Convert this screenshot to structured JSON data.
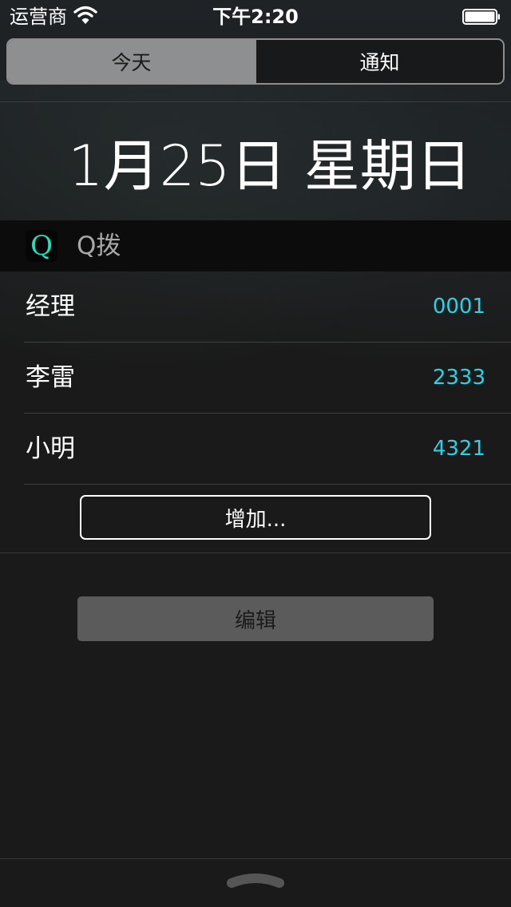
{
  "status_bar": {
    "carrier": "运营商",
    "time": "下午2:20",
    "wifi_icon": "wifi-icon",
    "battery_icon": "battery-icon"
  },
  "segments": [
    {
      "label": "今天",
      "selected": true
    },
    {
      "label": "通知",
      "selected": false
    }
  ],
  "date_heading": "1月25日 星期日",
  "widget": {
    "icon_letter": "Q",
    "title": "Q拨",
    "contacts": [
      {
        "name": "经理",
        "number": "0001"
      },
      {
        "name": "李雷",
        "number": "2333"
      },
      {
        "name": "小明",
        "number": "4321"
      }
    ],
    "add_label": "增加..."
  },
  "edit_label": "编辑",
  "colors": {
    "accent_number": "#2ad2e6",
    "icon_accent": "#1fe0b8",
    "background": "#1b1b1b"
  }
}
